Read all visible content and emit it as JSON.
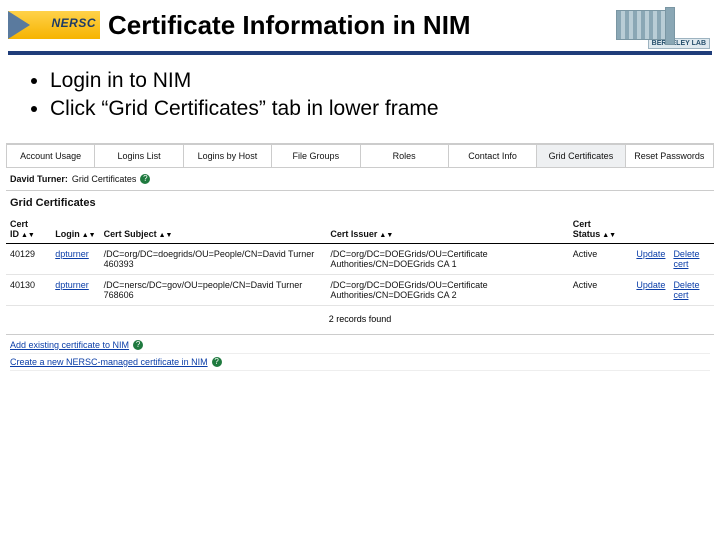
{
  "logos": {
    "nersc": "NERSC",
    "lab_caption": "BERKELEY LAB"
  },
  "title": "Certificate Information in NIM",
  "bullets": [
    "Login in to NIM",
    "Click “Grid Certificates” tab in lower frame"
  ],
  "tabs": [
    "Account Usage",
    "Logins List",
    "Logins by Host",
    "File Groups",
    "Roles",
    "Contact Info",
    "Grid Certificates",
    "Reset Passwords"
  ],
  "active_tab_index": 6,
  "subhead": {
    "name": "David Turner:",
    "label": "Grid Certificates"
  },
  "section_title": "Grid Certificates",
  "columns": [
    "Cert ID",
    "Login",
    "Cert Subject",
    "Cert Issuer",
    "Cert Status",
    "",
    ""
  ],
  "rows": [
    {
      "id": "40129",
      "login": "dpturner",
      "subject": "/DC=org/DC=doegrids/OU=People/CN=David Turner 460393",
      "issuer": "/DC=org/DC=DOEGrids/OU=Certificate Authorities/CN=DOEGrids CA 1",
      "status": "Active",
      "update": "Update",
      "delete": "Delete cert"
    },
    {
      "id": "40130",
      "login": "dpturner",
      "subject": "/DC=nersc/DC=gov/OU=people/CN=David Turner 768606",
      "issuer": "/DC=org/DC=DOEGrids/OU=Certificate Authorities/CN=DOEGrids CA 2",
      "status": "Active",
      "update": "Update",
      "delete": "Delete cert"
    }
  ],
  "records_found": "2 records found",
  "footer_links": [
    "Add existing certificate to NIM",
    "Create a new NERSC-managed certificate in NIM"
  ]
}
